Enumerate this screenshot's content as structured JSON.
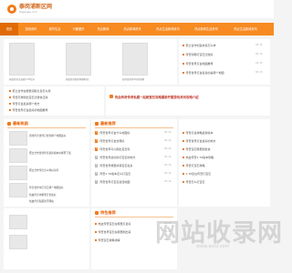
{
  "header": {
    "site_name": "泰岗浦新区网",
    "site_url": "taigangpu.com"
  },
  "nav": [
    {
      "label": "首页",
      "active": true
    },
    {
      "label": "游戏资讯"
    },
    {
      "label": "城市生活"
    },
    {
      "label": "兴趣爱好"
    },
    {
      "label": "热点新闻"
    },
    {
      "label": "热点新闻资讯"
    },
    {
      "label": "热点生活新闻资讯"
    },
    {
      "label": "热点新闻生活资讯"
    },
    {
      "label": "热点生活新闻资讯"
    }
  ],
  "top": {
    "thumb_captions": [
      "热血传奇合击版1.76怎么",
      "热血传奇新区开服时间",
      "仙剑奇侠传5前传攻略"
    ],
    "side_items": [
      {
        "text": "聚立合作创造未来怎么样",
        "date": "03-15"
      },
      {
        "text": "传奇到哪打宝石比较好",
        "date": "03-15"
      },
      {
        "text": "传奇世界打金地图推荐",
        "date": "03-15"
      },
      {
        "text": "传奇世界打金最多的是哪个地图",
        "date": "03-15"
      }
    ]
  },
  "feature": {
    "bullet_items": [
      {
        "text": "聚立合作在哪里领取礼包怎么用"
      },
      {
        "text": "传奇怎样刷出宝石比较快正版"
      },
      {
        "text": "传奇打金最多哪个地方"
      },
      {
        "text": "传奇世界打金最好的地图推荐"
      }
    ],
    "headline": "热血传奇传奇私服一起刷宝石攻略最新开服游戏资讯攻略介绍"
  },
  "sections": {
    "left": {
      "title": "最新热图",
      "items": [
        {
          "text": "游戏传奇世界打金到哪个地图最好"
        },
        {
          "text": "聚立合作游戏传奇最新版本在哪里下载"
        },
        {
          "text": "聚立合作传奇怎么样好玩吗"
        },
        {
          "text": "传奇世界中打宝石哪个地图最好"
        },
        {
          "text": "热血传奇中哪里打金最好"
        },
        {
          "text": "热血传奇私服新开网站"
        }
      ]
    },
    "middle": {
      "title": "最新推荐",
      "items": [
        {
          "text": "传奇世界打金什么地图好",
          "date": "03-14"
        },
        {
          "text": "传奇世界打金去哪好",
          "date": "03-14"
        },
        {
          "text": "传奇世界可以刷出宝石吗",
          "date": "03-14"
        },
        {
          "text": "传奇世界最好的打宝石的地方",
          "date": "03-14"
        },
        {
          "text": "传奇世界哪里掉落宝石最多",
          "date": "03-14"
        },
        {
          "text": "传奇1.76版本怎么打宝石",
          "date": "03-14"
        },
        {
          "text": "传奇世界打宝石最佳地图",
          "date": "03-14"
        }
      ]
    },
    "right": {
      "items": [
        {
          "text": "传奇打金攻略最新版本"
        },
        {
          "text": "传奇世界打金最好的地方"
        },
        {
          "text": "传奇宝石哪里刷最快"
        },
        {
          "text": "热血传奇1.76版本攻略"
        },
        {
          "text": "传奇打宝石攻略"
        },
        {
          "text": "1.76复古传奇打宝石"
        },
        {
          "text": "传奇怎么打宝石"
        }
      ]
    },
    "special": {
      "title": "特色推荐",
      "items": [
        {
          "text": "热血传奇宝石在哪里打最好",
          "date": "03-13"
        },
        {
          "text": "传奇世界宝石在哪里刷出来",
          "date": "03-13"
        },
        {
          "text": "传奇宝石攻略详解",
          "date": "03-13"
        }
      ]
    }
  },
  "watermark": {
    "text": "网站收录网",
    "url": "www.wzsl.com"
  }
}
